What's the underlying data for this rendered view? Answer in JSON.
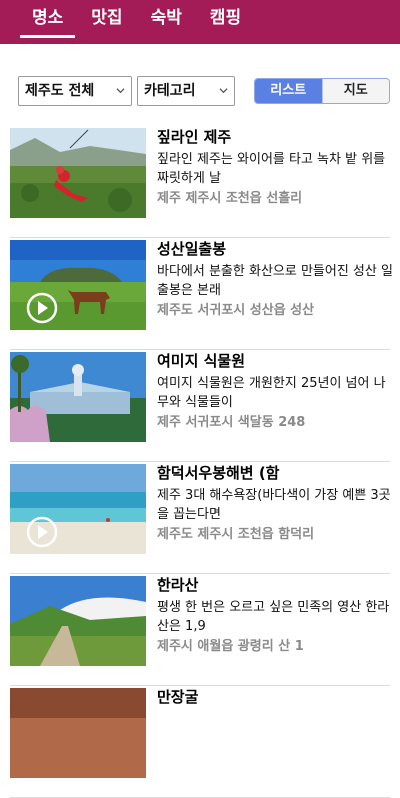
{
  "tabs": [
    {
      "label": "명소",
      "active": true
    },
    {
      "label": "맛집",
      "active": false
    },
    {
      "label": "숙박",
      "active": false
    },
    {
      "label": "캠핑",
      "active": false
    }
  ],
  "filters": {
    "region": "제주도 전체",
    "category": "카테고리",
    "view_list": "리스트",
    "view_map": "지도"
  },
  "items": [
    {
      "title": "짚라인 제주",
      "desc": "짚라인 제주는 와이어를 타고 녹차 밭 위를 짜릿하게 날",
      "addr": "제주 제주시 조천읍 선흘리",
      "video": false
    },
    {
      "title": "성산일출봉",
      "desc": "바다에서 분출한 화산으로 만들어진 성산 일출봉은 본래",
      "addr": "제주도 서귀포시 성산읍 성산",
      "video": true
    },
    {
      "title": "여미지 식물원",
      "desc": "여미지 식물원은 개원한지 25년이 넘어 나무와 식물들이",
      "addr": "제주 서귀포시 색달동 248",
      "video": false
    },
    {
      "title": "함덕서우봉해변 (함",
      "desc": "제주 3대 해수욕장(바다색이 가장 예쁜 3곳을 꼽는다면",
      "addr": "제주도 제주시 조천읍 함덕리",
      "video": true
    },
    {
      "title": "한라산",
      "desc": "평생 한 번은 오르고 싶은 민족의 영산 한라산은 1,9",
      "addr": "제주시 애월읍 광령리 산 1",
      "video": false
    },
    {
      "title": "만장굴",
      "desc": "",
      "addr": "",
      "video": false
    }
  ],
  "colors": {
    "topbar": "#a31c58",
    "accent": "#5b80e3"
  }
}
